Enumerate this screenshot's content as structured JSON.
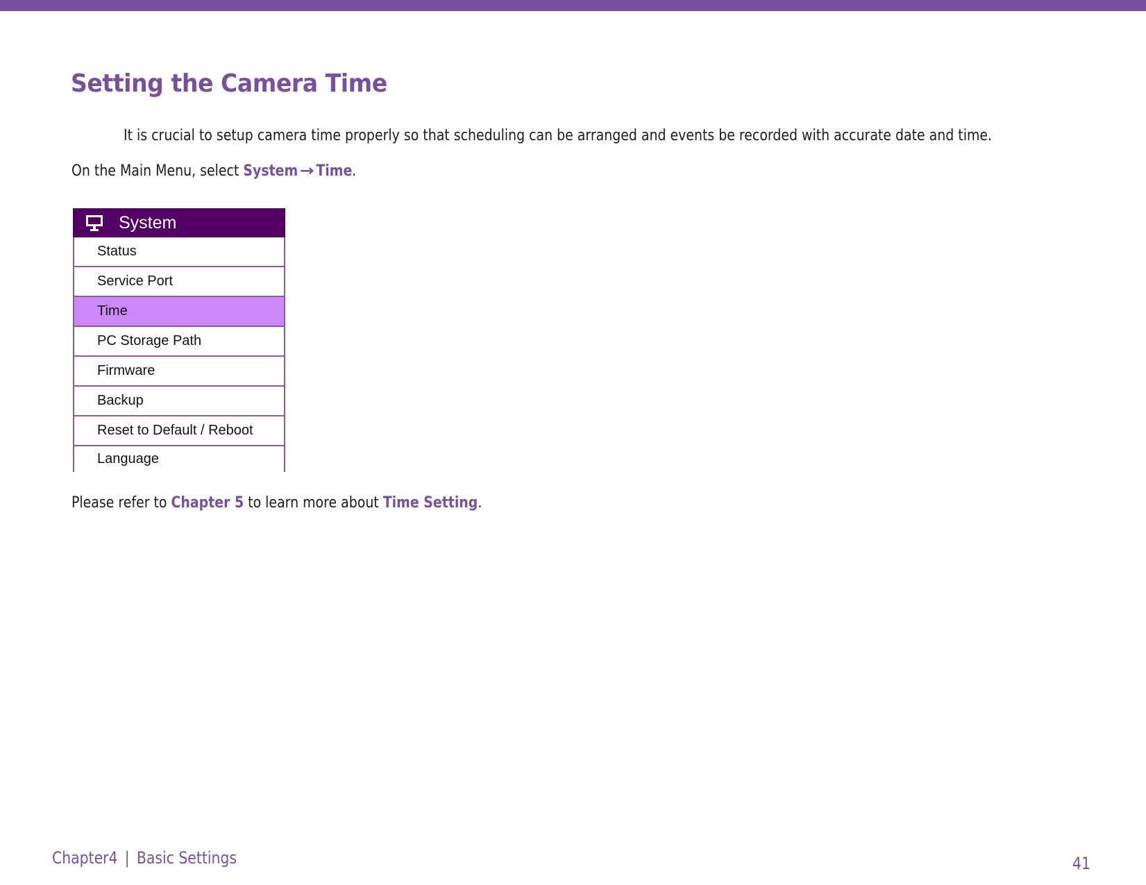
{
  "header": {
    "accent_color": "#77519b"
  },
  "title": "Setting the Camera Time",
  "intro": "It is crucial to setup camera time properly so that scheduling can be arranged and events be recorded with accurate date and time.",
  "instruction": {
    "prefix": "On the Main Menu, select ",
    "step1": "System",
    "arrow": "→",
    "step2": "Time",
    "suffix": "."
  },
  "menu": {
    "header_icon": "monitor-icon",
    "header_label": "System",
    "header_color": "#520064",
    "selected_color": "#cd88f7",
    "items": [
      {
        "label": "Status",
        "selected": false
      },
      {
        "label": "Service Port",
        "selected": false
      },
      {
        "label": "Time",
        "selected": true
      },
      {
        "label": "PC Storage Path",
        "selected": false
      },
      {
        "label": "Firmware",
        "selected": false
      },
      {
        "label": "Backup",
        "selected": false
      },
      {
        "label": "Reset to Default / Reboot",
        "selected": false
      },
      {
        "label": "Language",
        "selected": false
      }
    ]
  },
  "reference": {
    "prefix": "Please refer to ",
    "link1": "Chapter 5",
    "middle": " to learn more about ",
    "link2": "Time Setting",
    "suffix": "."
  },
  "footer": {
    "chapter": "Chapter4",
    "separator": "|",
    "section": "Basic Settings",
    "page_number": "41"
  }
}
